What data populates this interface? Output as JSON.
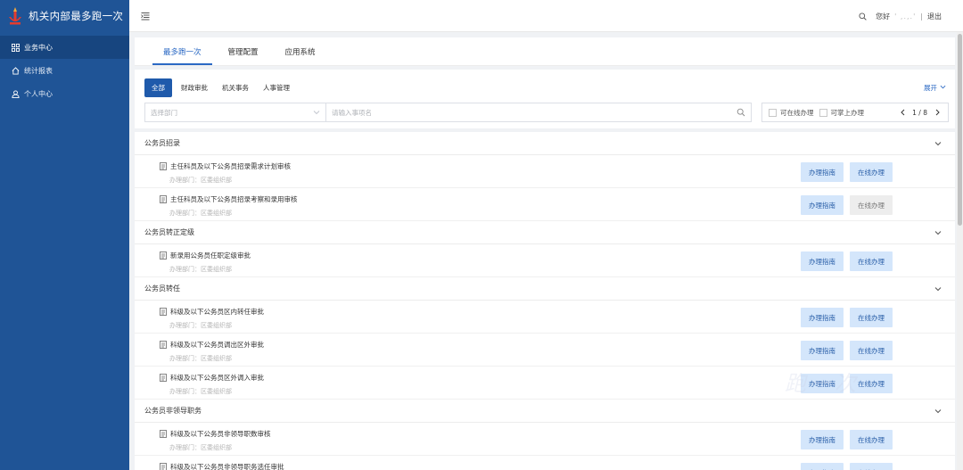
{
  "app": {
    "title": "机关内部最多跑一次"
  },
  "sidebar": {
    "items": [
      {
        "label": "业务中心",
        "icon": "grid-icon",
        "active": true
      },
      {
        "label": "统计报表",
        "icon": "home-icon",
        "active": false
      },
      {
        "label": "个人中心",
        "icon": "user-icon",
        "active": false
      }
    ]
  },
  "header": {
    "greeting": "您好",
    "user_name": "' ,.,.'",
    "separator": "|",
    "logout_label": "退出"
  },
  "tabs": [
    {
      "label": "最多跑一次",
      "active": true
    },
    {
      "label": "管理配置",
      "active": false
    },
    {
      "label": "应用系统",
      "active": false
    }
  ],
  "filters": {
    "chips": [
      {
        "label": "全部",
        "active": true
      },
      {
        "label": "财政审批",
        "active": false
      },
      {
        "label": "机关事务",
        "active": false
      },
      {
        "label": "人事管理",
        "active": false
      }
    ],
    "expand_label": "展开",
    "dept_placeholder": "选择部门",
    "search_placeholder": "请输入事项名",
    "online_label": "可在线办理",
    "apply_label": "可掌上办理",
    "page_indicator": "1 / 8"
  },
  "buttons": {
    "guide_label": "办理指南",
    "online_label": "在线办理"
  },
  "dept_prefix": "办理部门：区委组织部",
  "categories": [
    {
      "name": "公务员招录",
      "items": [
        {
          "title": "主任科员及以下公务员招录需求计划审核",
          "dept": "办理部门：区委组织部",
          "online_enabled": true
        },
        {
          "title": "主任科员及以下公务员招录考察和录用审核",
          "dept": "办理部门：区委组织部",
          "online_enabled": false
        }
      ]
    },
    {
      "name": "公务员转正定级",
      "items": [
        {
          "title": "新录用公务员任职定级审批",
          "dept": "办理部门：区委组织部",
          "online_enabled": true
        }
      ]
    },
    {
      "name": "公务员转任",
      "items": [
        {
          "title": "科级及以下公务员区内转任审批",
          "dept": "办理部门：区委组织部",
          "online_enabled": true
        },
        {
          "title": "科级及以下公务员调出区外审批",
          "dept": "办理部门：区委组织部",
          "online_enabled": true
        },
        {
          "title": "科级及以下公务员区外调入审批",
          "dept": "办理部门：区委组织部",
          "online_enabled": true
        }
      ]
    },
    {
      "name": "公务员非领导职务",
      "items": [
        {
          "title": "科级及以下公务员非领导职数审核",
          "dept": "办理部门：区委组织部",
          "online_enabled": true
        },
        {
          "title": "科级及以下公务员非领导职务选任审批",
          "dept": "",
          "online_enabled": true
        }
      ]
    }
  ],
  "watermark": "跑一次",
  "colors": {
    "sidebar": "#1f5496",
    "accent": "#2b69c4",
    "button_bg": "#d4e6fb"
  }
}
